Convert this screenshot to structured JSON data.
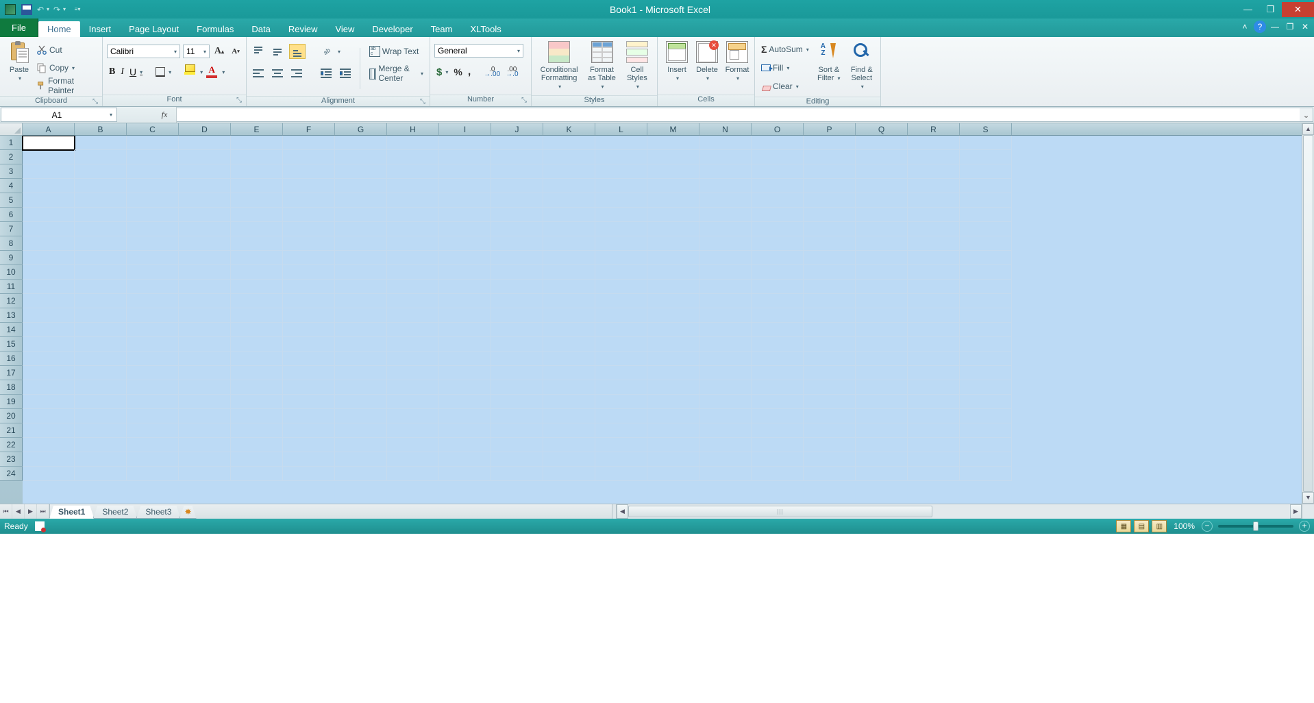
{
  "titlebar": {
    "title": "Book1 - Microsoft Excel",
    "qat": {
      "undo": "↶",
      "redo": "↷"
    }
  },
  "window_controls": {
    "minimize": "—",
    "maximize": "❐",
    "close": "✕"
  },
  "ribbon_tabs": {
    "file": "File",
    "items": [
      "Home",
      "Insert",
      "Page Layout",
      "Formulas",
      "Data",
      "Review",
      "View",
      "Developer",
      "Team",
      "XLTools"
    ],
    "active_index": 0
  },
  "ribbon_help": {
    "up": "˄",
    "help": "?",
    "min": "—",
    "restore": "❐",
    "close": "✕"
  },
  "clipboard": {
    "paste": "Paste",
    "cut": "Cut",
    "copy": "Copy",
    "format_painter": "Format Painter",
    "group": "Clipboard"
  },
  "font": {
    "name": "Calibri",
    "size": "11",
    "bold": "B",
    "italic": "I",
    "underline": "U",
    "group": "Font"
  },
  "alignment": {
    "wrap": "Wrap Text",
    "merge": "Merge & Center",
    "group": "Alignment"
  },
  "number": {
    "format": "General",
    "acct": "$",
    "pct": "%",
    "comma": ",",
    "inc_dec_top": ".0",
    "inc_arrow": "→.00",
    "dec_dec_top": ".00",
    "dec_arrow": "→.0",
    "group": "Number"
  },
  "styles": {
    "cf": "Conditional\nFormatting",
    "fat": "Format\nas Table",
    "cs": "Cell\nStyles",
    "group": "Styles"
  },
  "cells": {
    "insert": "Insert",
    "del": "Delete",
    "format": "Format",
    "group": "Cells"
  },
  "editing": {
    "sum": "Σ",
    "autosum": "AutoSum",
    "fill": "Fill",
    "clear": "Clear",
    "sort": "Sort &\nFilter",
    "find": "Find &\nSelect",
    "group": "Editing"
  },
  "formula_bar": {
    "name_box": "A1",
    "fx": "fx",
    "value": ""
  },
  "grid": {
    "columns": [
      "A",
      "B",
      "C",
      "D",
      "E",
      "F",
      "G",
      "H",
      "I",
      "J",
      "K",
      "L",
      "M",
      "N",
      "O",
      "P",
      "Q",
      "R",
      "S"
    ],
    "rows": [
      "1",
      "2",
      "3",
      "4",
      "5",
      "6",
      "7",
      "8",
      "9",
      "10",
      "11",
      "12",
      "13",
      "14",
      "15",
      "16",
      "17",
      "18",
      "19",
      "20",
      "21",
      "22",
      "23",
      "24"
    ],
    "active_cell": "A1"
  },
  "sheets": {
    "nav": {
      "first": "⏮",
      "prev": "◀",
      "next": "▶",
      "last": "⏭"
    },
    "tabs": [
      "Sheet1",
      "Sheet2",
      "Sheet3"
    ],
    "active_index": 0,
    "new_icon": "✶"
  },
  "status": {
    "state": "Ready",
    "zoom": "100%",
    "minus": "−",
    "plus": "+"
  }
}
